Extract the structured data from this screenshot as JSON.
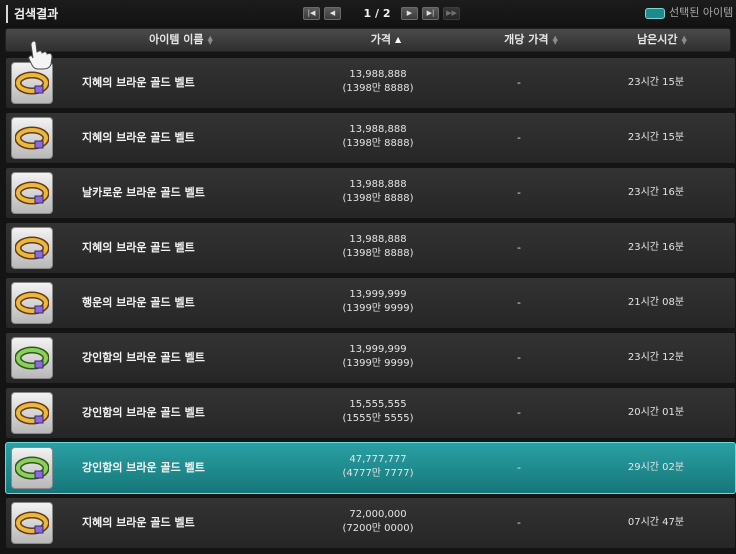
{
  "title": "검색결과",
  "pagination": {
    "first": "|◀",
    "prev": "◀",
    "page_text": "1 / 2",
    "next": "▶",
    "last": "▶|",
    "end": "▶▶"
  },
  "legend": {
    "label": "선택된 아이템",
    "color": "#1d8a8c"
  },
  "columns": {
    "name": "아이템 이름",
    "price": "가격",
    "unit_price": "개당 가격",
    "remaining": "남은시간"
  },
  "sort": {
    "column": "price",
    "direction": "ascending"
  },
  "items": [
    {
      "name": "지혜의 브라운 골드 벨트",
      "price": "13,988,888",
      "price_kr": "(1398만 8888)",
      "unit": "-",
      "time": "23시간 15분",
      "icon": "gold-belt-icon",
      "band": "#e8b93a",
      "selected": false
    },
    {
      "name": "지혜의 브라운 골드 벨트",
      "price": "13,988,888",
      "price_kr": "(1398만 8888)",
      "unit": "-",
      "time": "23시간 15분",
      "icon": "gold-belt-icon",
      "band": "#e8b93a",
      "selected": false
    },
    {
      "name": "날카로운 브라운 골드 벨트",
      "price": "13,988,888",
      "price_kr": "(1398만 8888)",
      "unit": "-",
      "time": "23시간 16분",
      "icon": "gold-belt-icon",
      "band": "#e8b93a",
      "selected": false
    },
    {
      "name": "지혜의 브라운 골드 벨트",
      "price": "13,988,888",
      "price_kr": "(1398만 8888)",
      "unit": "-",
      "time": "23시간 16분",
      "icon": "gold-belt-icon",
      "band": "#e8b93a",
      "selected": false
    },
    {
      "name": "행운의 브라운 골드 벨트",
      "price": "13,999,999",
      "price_kr": "(1399만 9999)",
      "unit": "-",
      "time": "21시간 08분",
      "icon": "gold-belt-icon",
      "band": "#e8b93a",
      "selected": false
    },
    {
      "name": "강인함의 브라운 골드 벨트",
      "price": "13,999,999",
      "price_kr": "(1399만 9999)",
      "unit": "-",
      "time": "23시간 12분",
      "icon": "green-belt-icon",
      "band": "#8ccf5a",
      "selected": false
    },
    {
      "name": "강인함의 브라운 골드 벨트",
      "price": "15,555,555",
      "price_kr": "(1555만 5555)",
      "unit": "-",
      "time": "20시간 01분",
      "icon": "gold-belt-icon",
      "band": "#e8b93a",
      "selected": false
    },
    {
      "name": "강인함의 브라운 골드 벨트",
      "price": "47,777,777",
      "price_kr": "(4777만 7777)",
      "unit": "-",
      "time": "29시간 02분",
      "icon": "green-belt-icon",
      "band": "#8ccf5a",
      "selected": true
    },
    {
      "name": "지혜의 브라운 골드 벨트",
      "price": "72,000,000",
      "price_kr": "(7200만 0000)",
      "unit": "-",
      "time": "07시간 47분",
      "icon": "gold-belt-icon",
      "band": "#e8b93a",
      "selected": false
    }
  ]
}
